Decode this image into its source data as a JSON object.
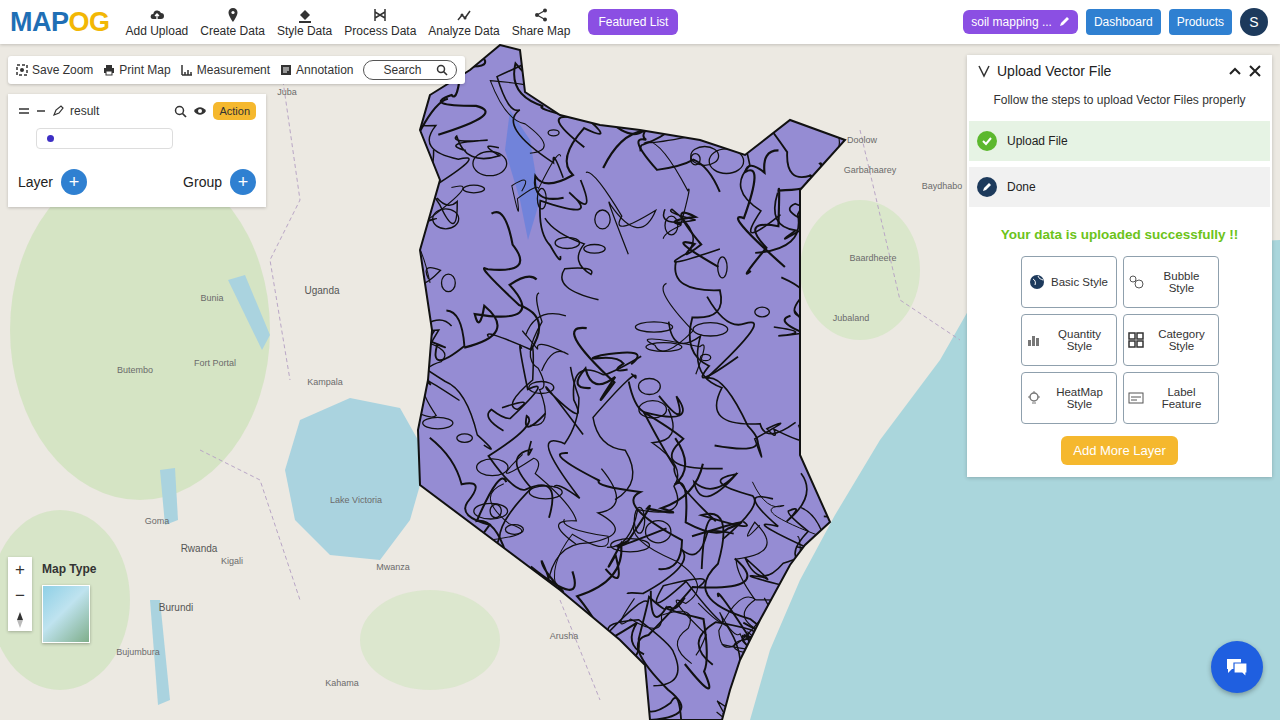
{
  "logo": [
    "MAP",
    "OG"
  ],
  "nav": [
    "Add Upload",
    "Create Data",
    "Style Data",
    "Process Data",
    "Analyze Data",
    "Share Map"
  ],
  "featured": "Featured List",
  "project": "soil mapping ...",
  "header_buttons": [
    "Dashboard",
    "Products"
  ],
  "avatar": "S",
  "toolbar": {
    "items": [
      "Save Zoom",
      "Print Map",
      "Measurement",
      "Annotation"
    ],
    "search": {
      "placeholder": "Search"
    }
  },
  "layer_panel": {
    "layer": {
      "name": "result",
      "visible": true,
      "color": "#3d2fc4"
    },
    "action": "Action",
    "add": [
      {
        "label": "Layer",
        "icon": "+"
      },
      {
        "label": "Group",
        "icon": "+"
      }
    ]
  },
  "map": {
    "map_type": "Map Type",
    "zoom": [
      "+",
      "−"
    ],
    "labels": [
      "Juba",
      "Uganda",
      "Kampala",
      "Lake Victoria",
      "Bunia",
      "Fort Portal",
      "Goma",
      "Rwanda",
      "Kigali",
      "Burundi",
      "Bujumbura",
      "Arusha",
      "Doolow",
      "Garbahaarey",
      "Baydhabo",
      "Baardheere",
      "Jubaland",
      "Butembo",
      "Mwanza",
      "Kahama"
    ]
  },
  "upload_panel": {
    "title": "Upload Vector File",
    "subtitle": "Follow the steps to upload Vector Files properly",
    "steps": [
      {
        "label": "Upload File",
        "completed": true
      },
      {
        "label": "Done",
        "completed": false
      }
    ],
    "message": "Your data is uploaded successfully !!",
    "styles": [
      "Basic Style",
      "Bubble Style",
      "Quantity Style",
      "Category Style",
      "HeatMap Style",
      "Label Feature"
    ],
    "add_more": "Add More Layer"
  }
}
